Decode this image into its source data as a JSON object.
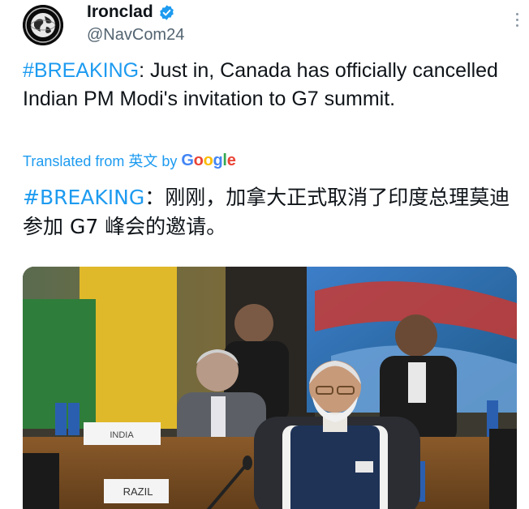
{
  "author": {
    "display_name": "Ironclad",
    "handle": "@NavCom24",
    "avatar_icon": "globe-emblem-icon",
    "verified_icon": "verified-badge-icon",
    "verified_color": "#1d9bf0"
  },
  "tweet": {
    "hashtag": "#BREAKING",
    "text": ": Just in, Canada has officially cancelled Indian PM Modi's invitation to G7 summit."
  },
  "translation": {
    "label_prefix": "Translated from 英文 by",
    "provider": "Google",
    "hashtag": "#BREAKING",
    "text": "：刚刚，加拿大正式取消了印度总理莫迪参加 G7 峰会的邀请。"
  },
  "media": {
    "placards": [
      "INDIA",
      "RAZIL"
    ]
  },
  "colors": {
    "accent": "#1d9bf0",
    "text": "#0f1419",
    "muted": "#536471"
  }
}
